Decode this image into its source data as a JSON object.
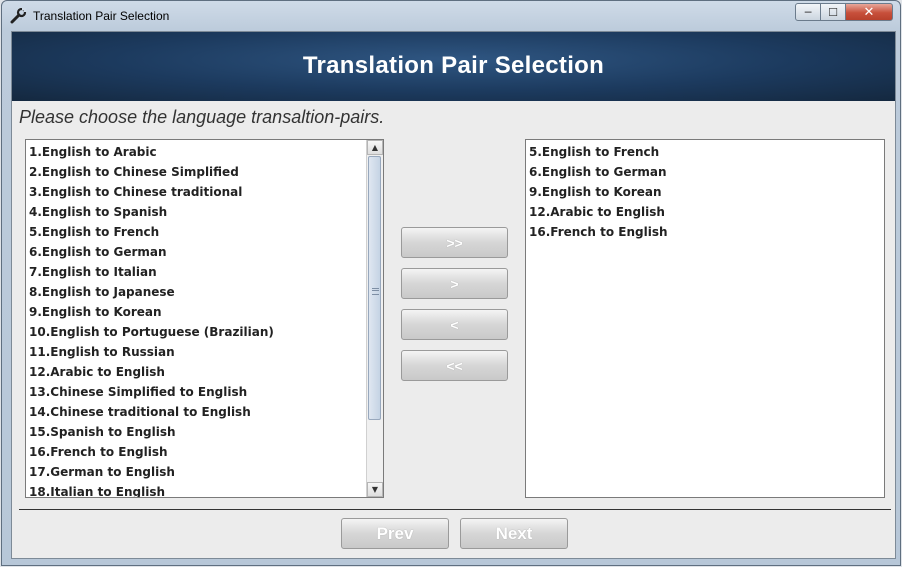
{
  "window": {
    "title": "Translation Pair Selection",
    "controls": {
      "minimize": "─",
      "maximize": "☐",
      "close": "✕"
    }
  },
  "banner": {
    "heading": "Translation Pair Selection"
  },
  "instruction": "Please choose the language transaltion-pairs.",
  "available_pairs": [
    "1.English to Arabic",
    "2.English to Chinese Simplified",
    "3.English to Chinese traditional",
    "4.English to Spanish",
    "5.English to French",
    "6.English to German",
    "7.English to Italian",
    "8.English to Japanese",
    "9.English to Korean",
    "10.English to Portuguese (Brazilian)",
    "11.English to Russian",
    "12.Arabic to English",
    "13.Chinese Simplified to English",
    "14.Chinese traditional to English",
    "15.Spanish to English",
    "16.French to English",
    "17.German to English",
    "18.Italian to English"
  ],
  "selected_pairs": [
    "5.English to French",
    "6.English to German",
    "9.English to Korean",
    "12.Arabic to English",
    "16.French to English"
  ],
  "move_buttons": {
    "add_all": ">>",
    "add": ">",
    "remove": "<",
    "remove_all": "<<"
  },
  "nav": {
    "prev": "Prev",
    "next": "Next"
  },
  "scroll_icons": {
    "up": "▲",
    "down": "▼"
  }
}
